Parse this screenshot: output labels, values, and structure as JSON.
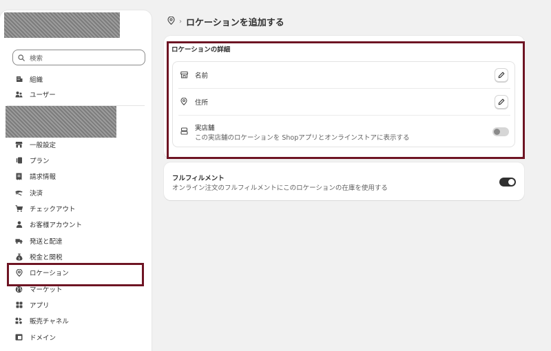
{
  "sidebar": {
    "search_placeholder": "検索",
    "top_items": [
      {
        "label": "組織",
        "icon": "building-icon"
      },
      {
        "label": "ユーザー",
        "icon": "users-icon"
      }
    ],
    "items": [
      {
        "label": "一般設定",
        "icon": "store-icon"
      },
      {
        "label": "プラン",
        "icon": "plan-icon"
      },
      {
        "label": "請求情報",
        "icon": "receipt-icon"
      },
      {
        "label": "決済",
        "icon": "payment-icon"
      },
      {
        "label": "チェックアウト",
        "icon": "cart-icon"
      },
      {
        "label": "お客様アカウント",
        "icon": "person-icon"
      },
      {
        "label": "発送と配達",
        "icon": "truck-icon"
      },
      {
        "label": "税金と関税",
        "icon": "tax-bag-icon"
      },
      {
        "label": "ロケーション",
        "icon": "location-pin-icon"
      },
      {
        "label": "マーケット",
        "icon": "globe-icon"
      },
      {
        "label": "アプリ",
        "icon": "apps-icon"
      },
      {
        "label": "販売チャネル",
        "icon": "channels-icon"
      },
      {
        "label": "ドメイン",
        "icon": "domain-icon"
      }
    ]
  },
  "breadcrumb": {
    "separator": "›",
    "title": "ロケーションを追加する"
  },
  "details": {
    "section_title": "ロケーションの詳細",
    "name_label": "名前",
    "address_label": "住所",
    "store_label": "実店舗",
    "store_description": "この実店舗のロケーションを Shopアプリとオンラインストアに表示する",
    "store_toggle_on": false
  },
  "fulfillment": {
    "title": "フルフィルメント",
    "description": "オンライン注文のフルフィルメントにこのロケーションの在庫を使用する",
    "toggle_on": true
  },
  "colors": {
    "highlight": "#6e1423",
    "text": "#303030",
    "subtext": "#616161",
    "background": "#f1f1f1"
  }
}
